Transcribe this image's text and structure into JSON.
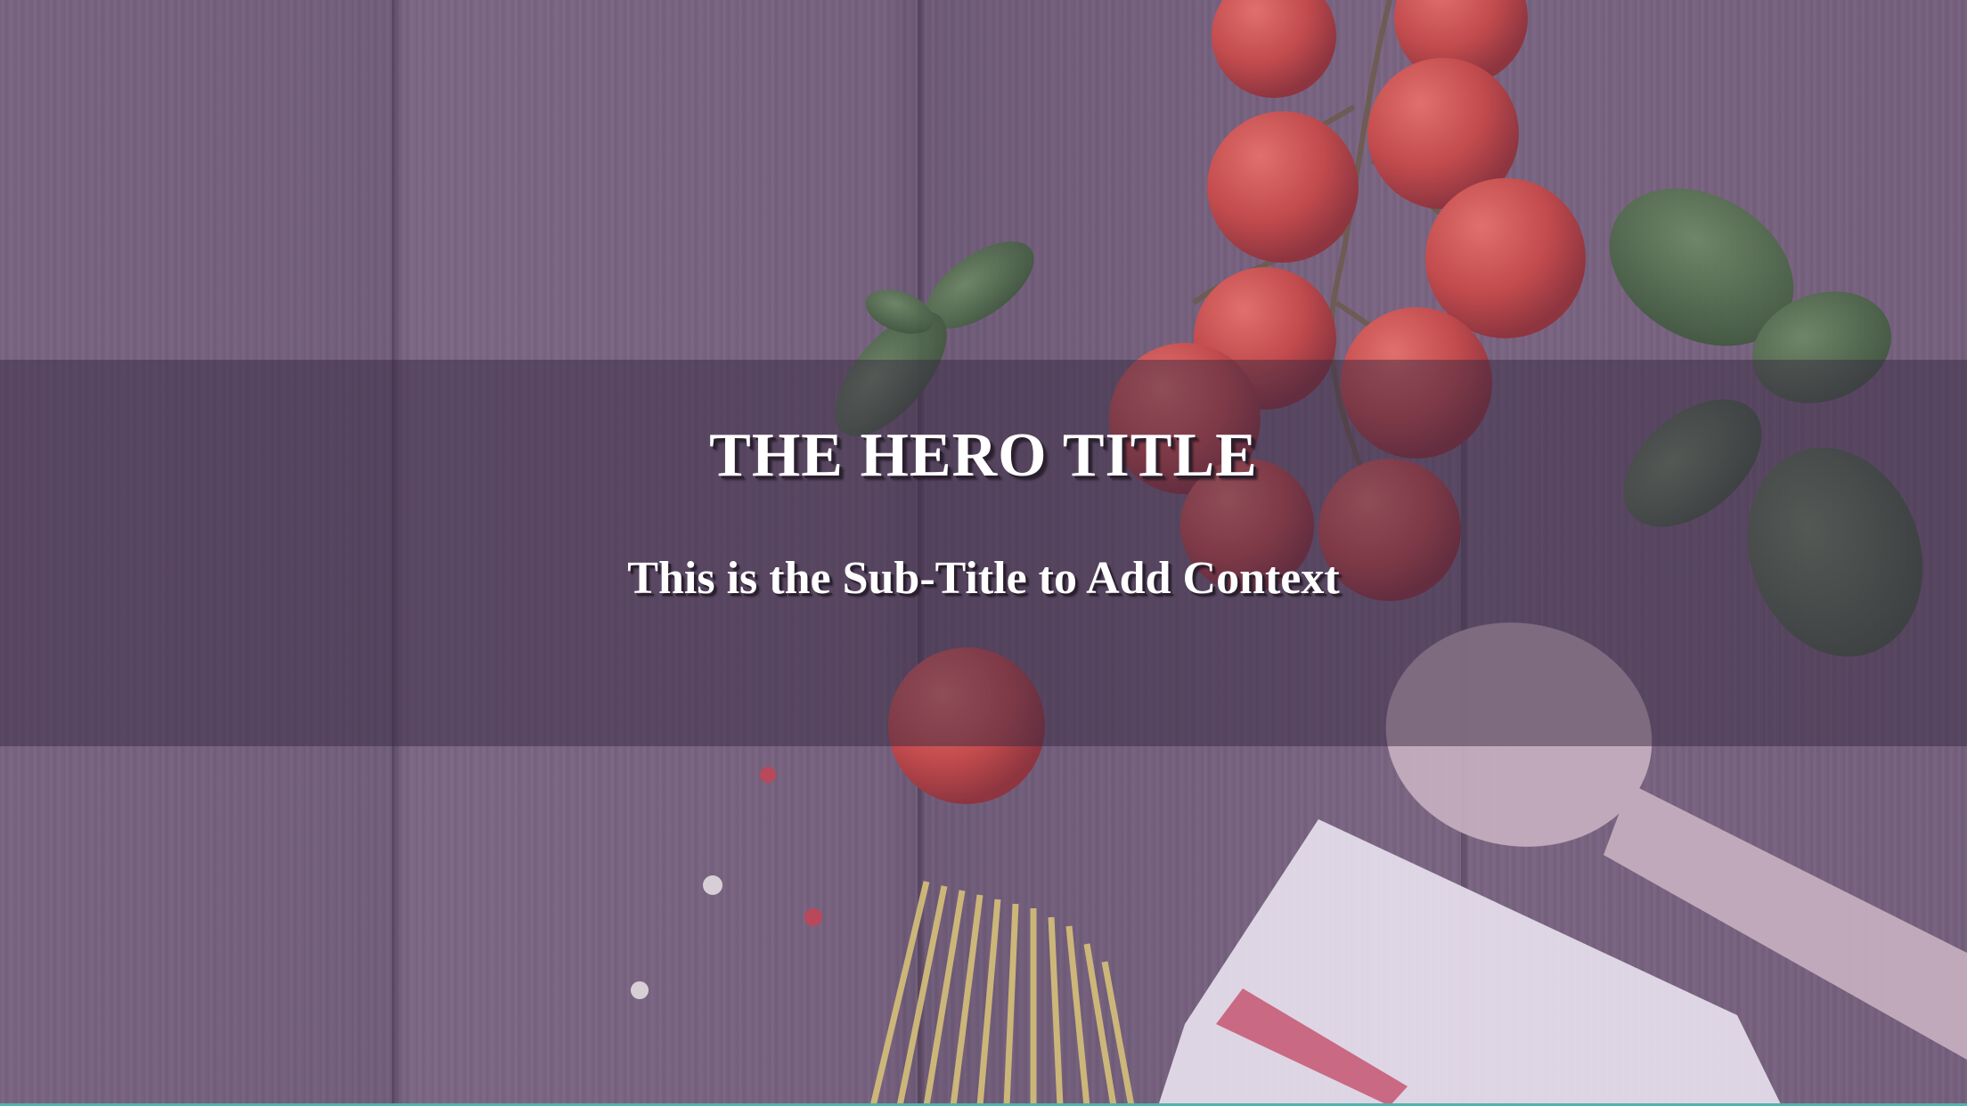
{
  "hero": {
    "title": "THE HERO TITLE",
    "subtitle": "This is the Sub-Title to Add Context"
  },
  "colors": {
    "overlay": "#5a4568",
    "tomato": "#c9504f",
    "basil": "#4f6a4a",
    "spoon": "#c9b3c2",
    "pasta": "#d8c27a",
    "towel": "#e8dfee",
    "towel_stripe": "#c85d78"
  }
}
